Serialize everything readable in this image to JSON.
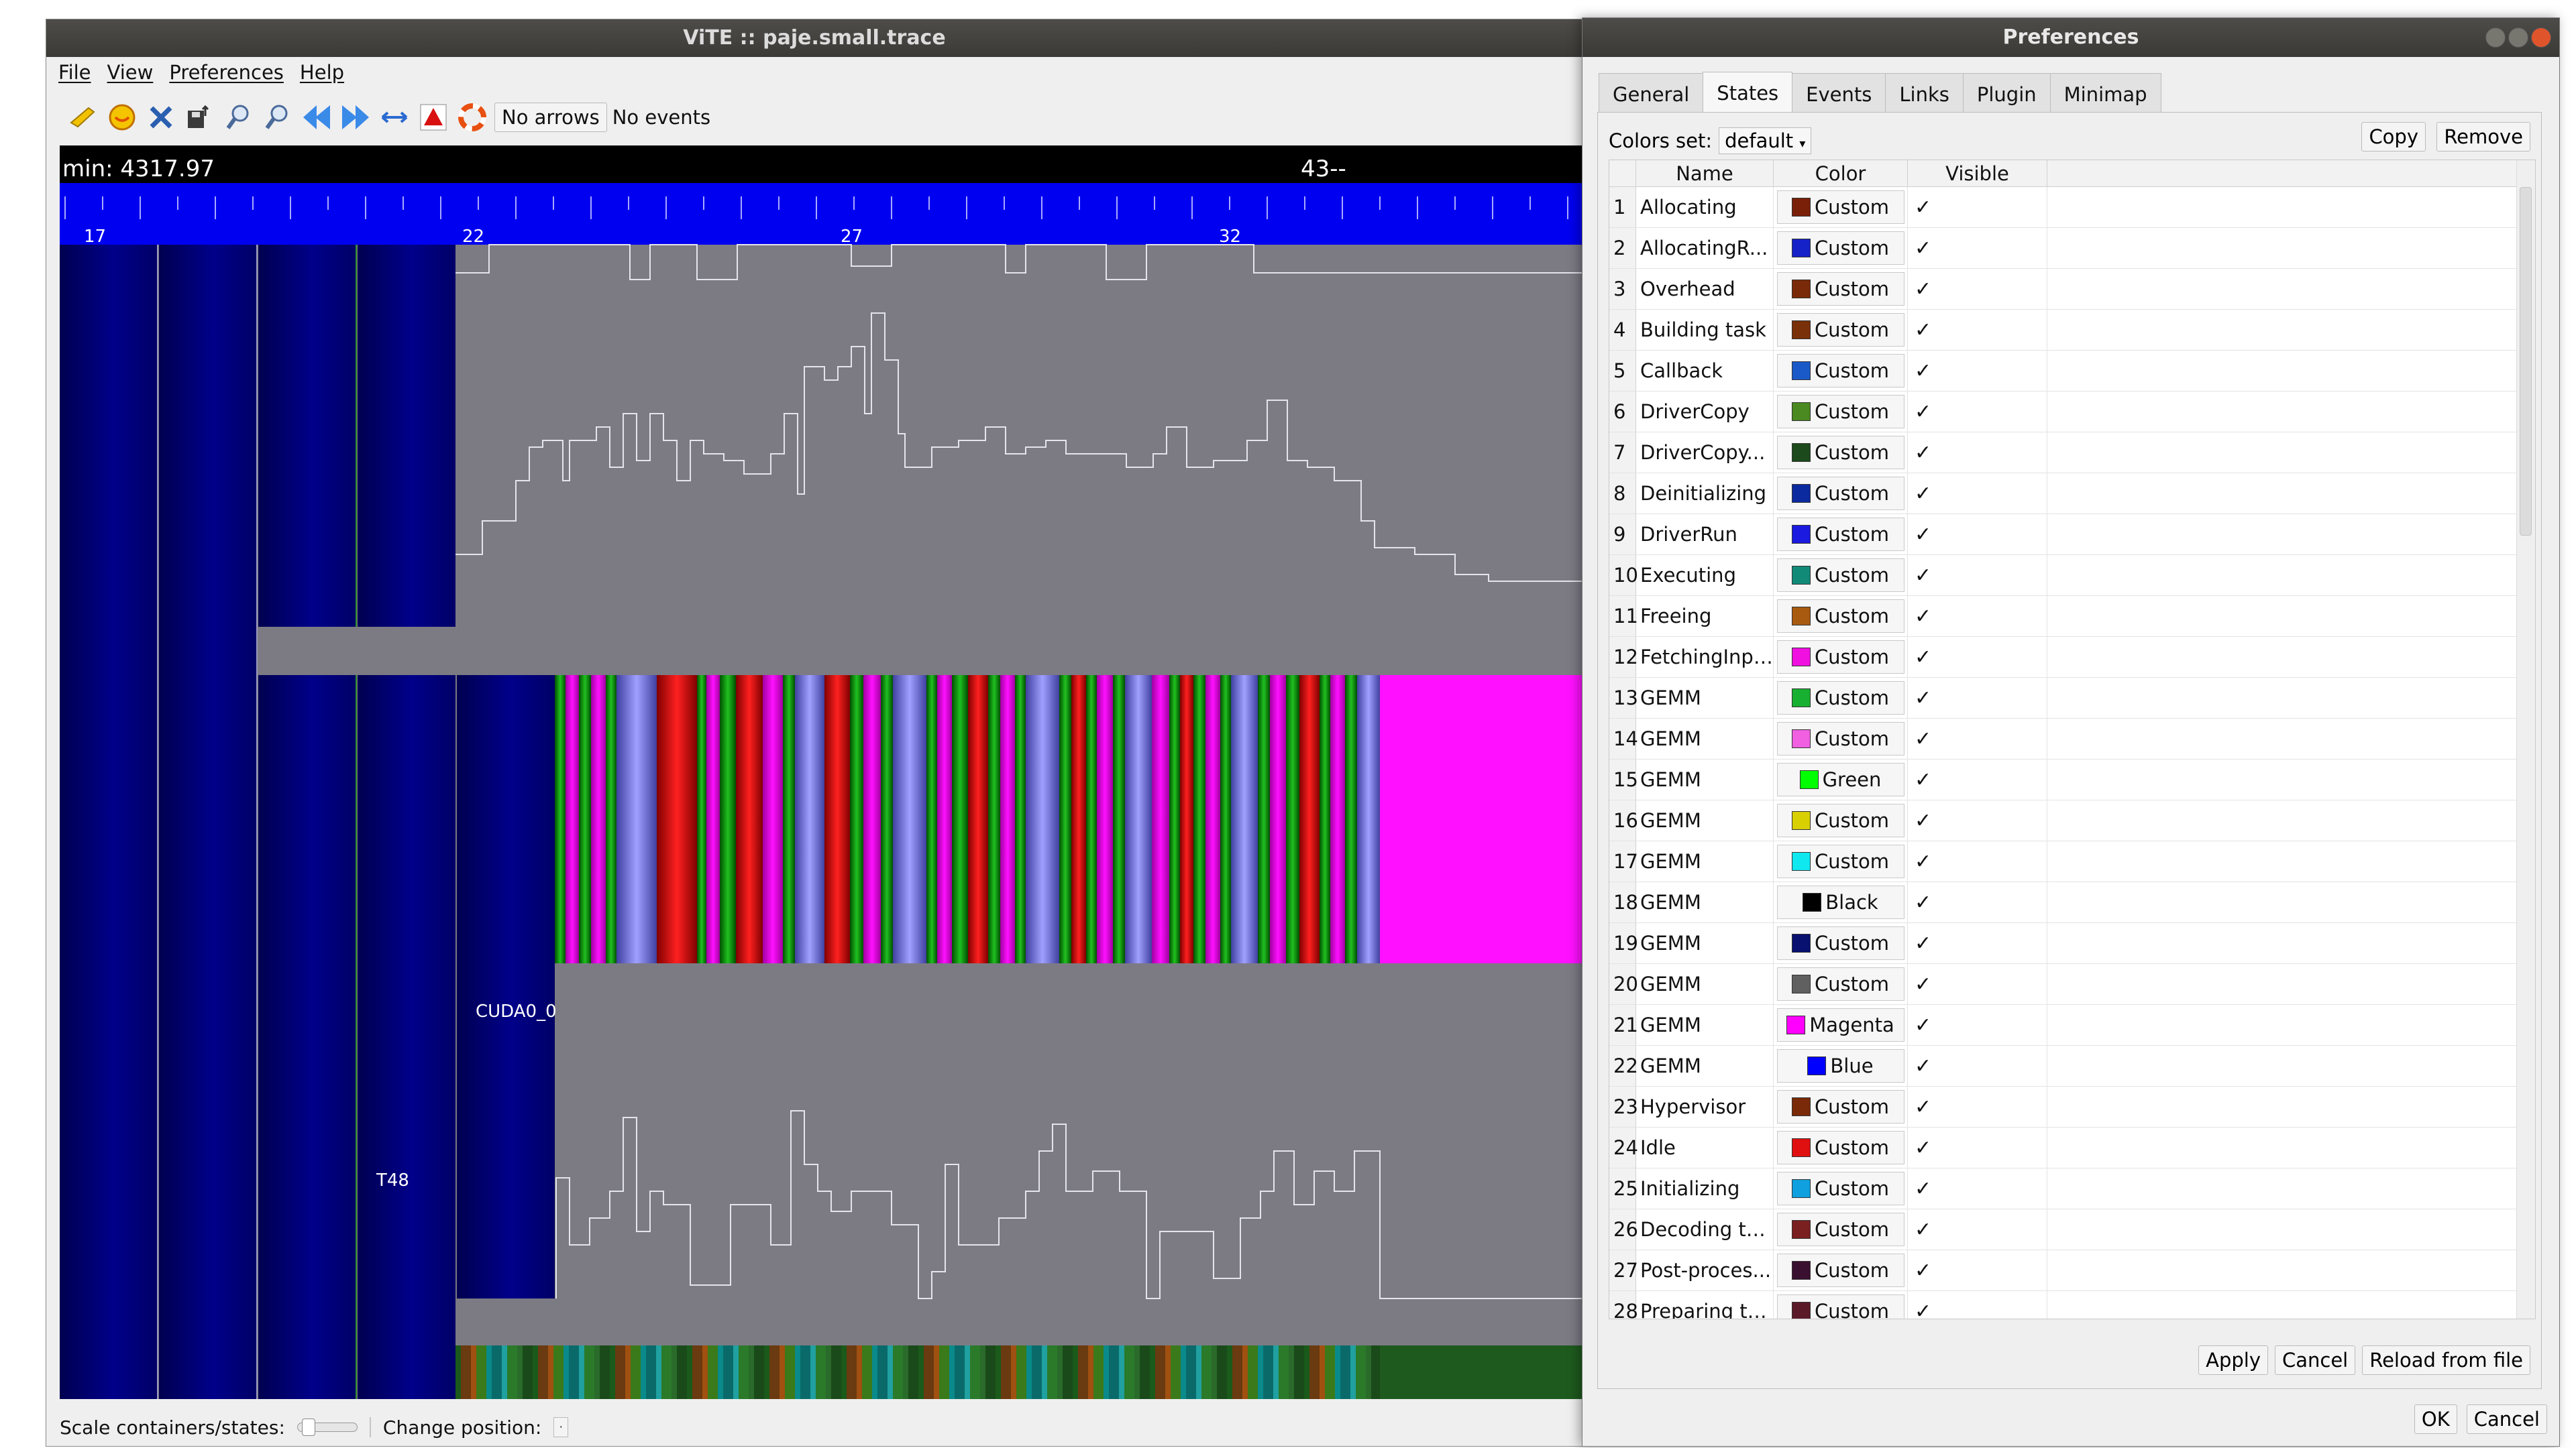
{
  "main": {
    "title": "ViTE :: paje.small.trace",
    "menu": [
      "File",
      "View",
      "Preferences",
      "Help"
    ],
    "toolbar": {
      "icons": [
        "open-folder-icon",
        "face-icon",
        "close-x-icon",
        "export-icon",
        "zoom-in-icon",
        "zoom-out-icon",
        "scroll-left-icon",
        "scroll-right-icon",
        "fit-horizontal-icon",
        "arrow-up-icon",
        "lifebuoy-icon"
      ],
      "arrows_label": "No arrows",
      "events_label": "No events"
    },
    "canvas": {
      "min_label": "min: 4317.97",
      "max_label": "43--",
      "ruler_ticks": [
        "17",
        "22",
        "27",
        "32"
      ],
      "container_labels": [
        "CUDA0_0",
        "T48"
      ],
      "colors": {
        "ruler": "#0000f0",
        "background": "#7c7b84",
        "container": "#00007a"
      }
    },
    "status": {
      "scale_label": "Scale containers/states:",
      "position_label": "Change position:"
    }
  },
  "preferences": {
    "title": "Preferences",
    "tabs": [
      "General",
      "States",
      "Events",
      "Links",
      "Plugin",
      "Minimap"
    ],
    "active_tab": "States",
    "colors_set_label": "Colors set:",
    "colors_set_value": "default",
    "copy_label": "Copy",
    "remove_label": "Remove",
    "columns": [
      "Name",
      "Color",
      "Visible"
    ],
    "rows": [
      {
        "num": "1",
        "name": "Allocating",
        "color": "#7a2008",
        "color_label": "Custom",
        "visible": "✓"
      },
      {
        "num": "2",
        "name": "AllocatingR...",
        "color": "#1522c8",
        "color_label": "Custom",
        "visible": "✓"
      },
      {
        "num": "3",
        "name": "Overhead",
        "color": "#7a2a08",
        "color_label": "Custom",
        "visible": "✓"
      },
      {
        "num": "4",
        "name": "Building task",
        "color": "#7a3008",
        "color_label": "Custom",
        "visible": "✓"
      },
      {
        "num": "5",
        "name": "Callback",
        "color": "#1a5ac8",
        "color_label": "Custom",
        "visible": "✓"
      },
      {
        "num": "6",
        "name": "DriverCopy",
        "color": "#4a8a20",
        "color_label": "Custom",
        "visible": "✓"
      },
      {
        "num": "7",
        "name": "DriverCopy...",
        "color": "#1c4a1c",
        "color_label": "Custom",
        "visible": "✓"
      },
      {
        "num": "8",
        "name": "Deinitializing",
        "color": "#0c2aa0",
        "color_label": "Custom",
        "visible": "✓"
      },
      {
        "num": "9",
        "name": "DriverRun",
        "color": "#1a1ae0",
        "color_label": "Custom",
        "visible": "✓"
      },
      {
        "num": "10",
        "name": "Executing",
        "color": "#128a78",
        "color_label": "Custom",
        "visible": "✓"
      },
      {
        "num": "11",
        "name": "Freeing",
        "color": "#a85a10",
        "color_label": "Custom",
        "visible": "✓"
      },
      {
        "num": "12",
        "name": "FetchingInput",
        "color": "#f010e0",
        "color_label": "Custom",
        "visible": "✓"
      },
      {
        "num": "13",
        "name": "GEMM",
        "color": "#18b030",
        "color_label": "Custom",
        "visible": "✓"
      },
      {
        "num": "14",
        "name": "GEMM",
        "color": "#f060e0",
        "color_label": "Custom",
        "visible": "✓"
      },
      {
        "num": "15",
        "name": "GEMM",
        "color": "#00ff00",
        "color_label": "Green",
        "visible": "✓"
      },
      {
        "num": "16",
        "name": "GEMM",
        "color": "#d8d000",
        "color_label": "Custom",
        "visible": "✓"
      },
      {
        "num": "17",
        "name": "GEMM",
        "color": "#10e8f0",
        "color_label": "Custom",
        "visible": "✓"
      },
      {
        "num": "18",
        "name": "GEMM",
        "color": "#000000",
        "color_label": "Black",
        "visible": "✓"
      },
      {
        "num": "19",
        "name": "GEMM",
        "color": "#081070",
        "color_label": "Custom",
        "visible": "✓"
      },
      {
        "num": "20",
        "name": "GEMM",
        "color": "#606060",
        "color_label": "Custom",
        "visible": "✓"
      },
      {
        "num": "21",
        "name": "GEMM",
        "color": "#ff00ff",
        "color_label": "Magenta",
        "visible": "✓"
      },
      {
        "num": "22",
        "name": "GEMM",
        "color": "#0000ff",
        "color_label": "Blue",
        "visible": "✓"
      },
      {
        "num": "23",
        "name": "Hypervisor",
        "color": "#7a2a08",
        "color_label": "Custom",
        "visible": "✓"
      },
      {
        "num": "24",
        "name": "Idle",
        "color": "#e01010",
        "color_label": "Custom",
        "visible": "✓"
      },
      {
        "num": "25",
        "name": "Initializing",
        "color": "#10a0e0",
        "color_label": "Custom",
        "visible": "✓"
      },
      {
        "num": "26",
        "name": "Decoding ta...",
        "color": "#7a2020",
        "color_label": "Custom",
        "visible": "✓"
      },
      {
        "num": "27",
        "name": "Post-proces...",
        "color": "#3a1030",
        "color_label": "Custom",
        "visible": "✓"
      },
      {
        "num": "28",
        "name": "Preparing ta...",
        "color": "#5a1a28",
        "color_label": "Custom",
        "visible": "✓"
      }
    ],
    "apply_label": "Apply",
    "cancel_pane_label": "Cancel",
    "reload_label": "Reload from file",
    "ok_label": "OK",
    "cancel_label": "Cancel"
  }
}
